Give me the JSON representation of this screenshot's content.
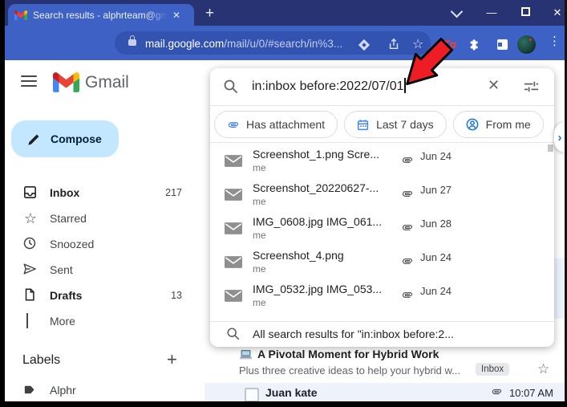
{
  "colors": {
    "titlebar": "#283373",
    "tab_toolbar": "#3d61c4",
    "omnibox": "#3353b0",
    "compose_bg": "#c2e7ff",
    "chip_icon_blue": "#4285f4",
    "arrow_red": "#ee1c25",
    "read_row_bg": "#eef3fb",
    "side_chevron_blue": "#1a73e8"
  },
  "window": {
    "tab_title": "Search results - alphrteam@gmai",
    "tab_close": "✕",
    "new_tab": "+",
    "tab_search_chevron": "v",
    "minimize": "—",
    "close": "✕"
  },
  "toolbar": {
    "back": "←",
    "forward": "→",
    "reload": "↻",
    "home": "⌂",
    "url_domain": "mail.google.com",
    "url_path": "/mail/u/0/#search/in%3...",
    "bookmark_star": "☆",
    "tp_extension": "Tp",
    "menu_dots": "⋮"
  },
  "gmail": {
    "brand": "Gmail",
    "compose_label": "Compose",
    "sidebar": {
      "items": [
        {
          "label": "Inbox",
          "count": "217"
        },
        {
          "label": "Starred",
          "count": ""
        },
        {
          "label": "Snoozed",
          "count": ""
        },
        {
          "label": "Sent",
          "count": ""
        },
        {
          "label": "Drafts",
          "count": "13"
        },
        {
          "label": "More",
          "count": ""
        }
      ],
      "labels_header": "Labels",
      "labels_add": "+",
      "labels": [
        {
          "name": "Alphr"
        }
      ]
    },
    "search": {
      "value": "in:inbox before:2022/07/01",
      "clear": "✕"
    },
    "chips": [
      {
        "label": "Has attachment"
      },
      {
        "label": "Last 7 days"
      },
      {
        "label": "From me"
      }
    ],
    "suggestions": [
      {
        "title": "Screenshot_1.png Scre...",
        "from": "me",
        "date": "Jun 24"
      },
      {
        "title": "Screenshot_20220627-...",
        "from": "me",
        "date": "Jun 27"
      },
      {
        "title": "IMG_0608.jpg IMG_061...",
        "from": "me",
        "date": "Jun 28"
      },
      {
        "title": "Screenshot_4.png",
        "from": "me",
        "date": "Jun 24"
      },
      {
        "title": "IMG_0532.jpg IMG_053...",
        "from": "me",
        "date": "Jun 24"
      }
    ],
    "footer": "All search results for \"in:inbox before:2...",
    "emails": [
      {
        "title": "A Pivotal Moment for Hybrid Work",
        "snippet": "Plus three creative ideas to help your hybrid w...",
        "badge": "Inbox",
        "star": "☆"
      },
      {
        "from": "Juan kate",
        "time": "10:07 AM"
      }
    ],
    "side_panel_chevron": "›"
  }
}
